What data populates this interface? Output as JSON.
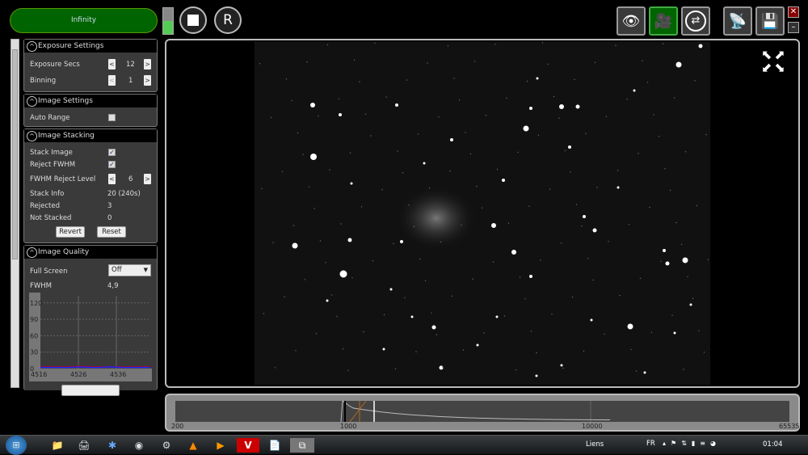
{
  "toolbar": {
    "target_label": "Infinity",
    "level": 0.5,
    "stop_icon": "stop-icon",
    "restart_label": "R",
    "icons": [
      "eye-icon",
      "video-camera-icon",
      "loop-icon",
      "antenna-icon",
      "save-icon"
    ],
    "close": "✕",
    "minimize": "–"
  },
  "panels": {
    "exposure": {
      "title": "Exposure Settings",
      "exposure_label": "Exposure Secs",
      "exposure_value": "12",
      "binning_label": "Binning",
      "binning_value": "1"
    },
    "image_settings": {
      "title": "Image Settings",
      "auto_range_label": "Auto Range",
      "auto_range": false
    },
    "stacking": {
      "title": "Image Stacking",
      "stack_image_label": "Stack Image",
      "stack_image": true,
      "reject_fwhm_label": "Reject FWHM",
      "reject_fwhm": true,
      "reject_level_label": "FWHM Reject Level",
      "reject_level_value": "6",
      "stack_info_label": "Stack Info",
      "stack_info_value": "20 (240s)",
      "rejected_label": "Rejected",
      "rejected_value": "3",
      "not_stacked_label": "Not Stacked",
      "not_stacked_value": "0",
      "revert_label": "Revert",
      "reset_label": "Reset"
    },
    "quality": {
      "title": "Image Quality",
      "full_screen_label": "Full Screen",
      "full_screen_value": "Off",
      "fwhm_label": "FWHM",
      "fwhm_value": "4,9"
    }
  },
  "chart_data": {
    "type": "line",
    "yticks": [
      "120",
      "90",
      "60",
      "30",
      "0"
    ],
    "xticks": [
      "4516",
      "4526",
      "4536"
    ],
    "ylim": [
      0,
      130
    ],
    "series": [
      {
        "name": "red",
        "color": "#d00000",
        "values": [
          3,
          3,
          3,
          3,
          4,
          3,
          3,
          3,
          3,
          3,
          3,
          3
        ]
      },
      {
        "name": "blue",
        "color": "#2020ff",
        "values": [
          2,
          2,
          2,
          2,
          3,
          2,
          2,
          3,
          2,
          2,
          2,
          2
        ]
      }
    ]
  },
  "histogram": {
    "labels": [
      "200",
      "1000",
      "10000",
      "65535"
    ]
  },
  "taskbar": {
    "links_label": "Liens",
    "lang": "FR",
    "time": "01:04"
  }
}
